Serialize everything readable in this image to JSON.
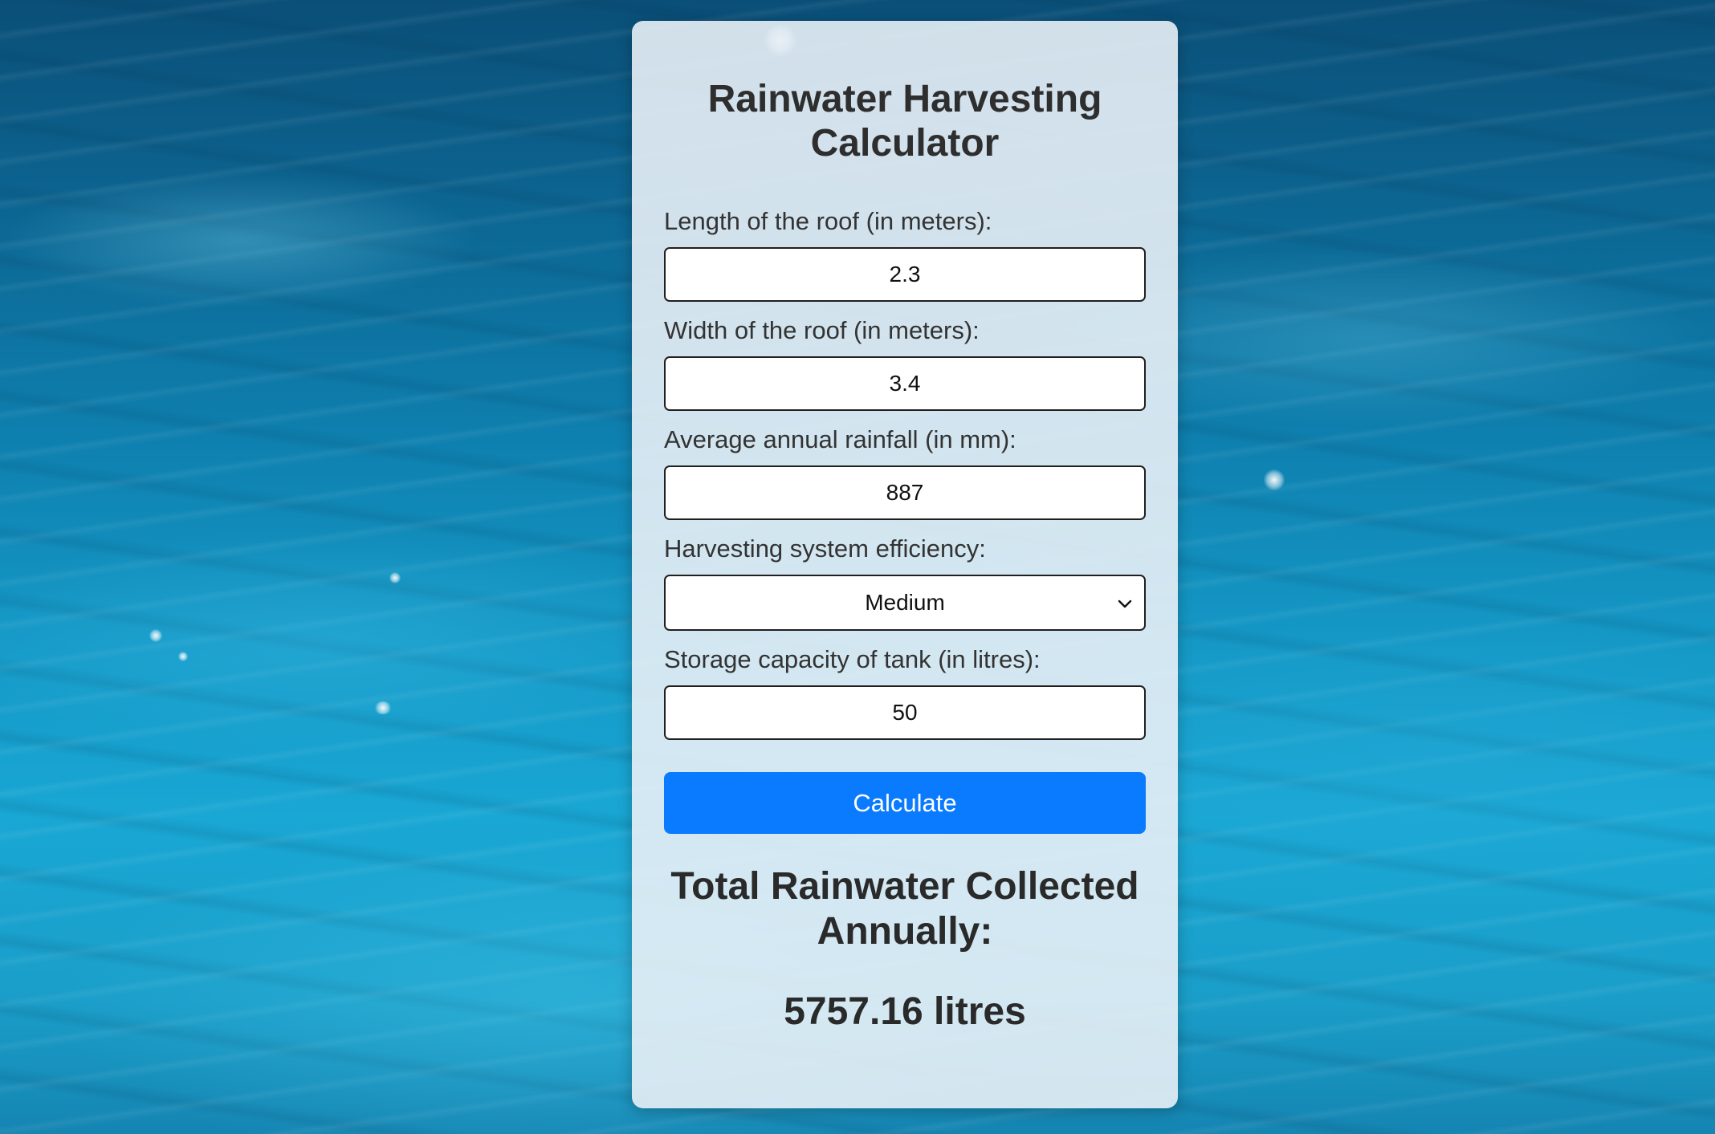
{
  "calculator": {
    "title": "Rainwater Harvesting Calculator",
    "fields": [
      {
        "label": "Length of the roof (in meters):",
        "value": "2.3"
      },
      {
        "label": "Width of the roof (in meters):",
        "value": "3.4"
      },
      {
        "label": "Average annual rainfall (in mm):",
        "value": "887"
      },
      {
        "label": "Harvesting system efficiency:",
        "selected": "Medium",
        "icon": "chevron-down-icon"
      },
      {
        "label": "Storage capacity of tank (in litres):",
        "value": "50"
      }
    ],
    "button_label": "Calculate",
    "result_heading": "Total Rainwater Collected Annually:",
    "result_value": "5757.16 litres"
  },
  "colors": {
    "button": "#0a7bff",
    "card_background": "#e8f0f6",
    "text": "#2e2e2e"
  }
}
